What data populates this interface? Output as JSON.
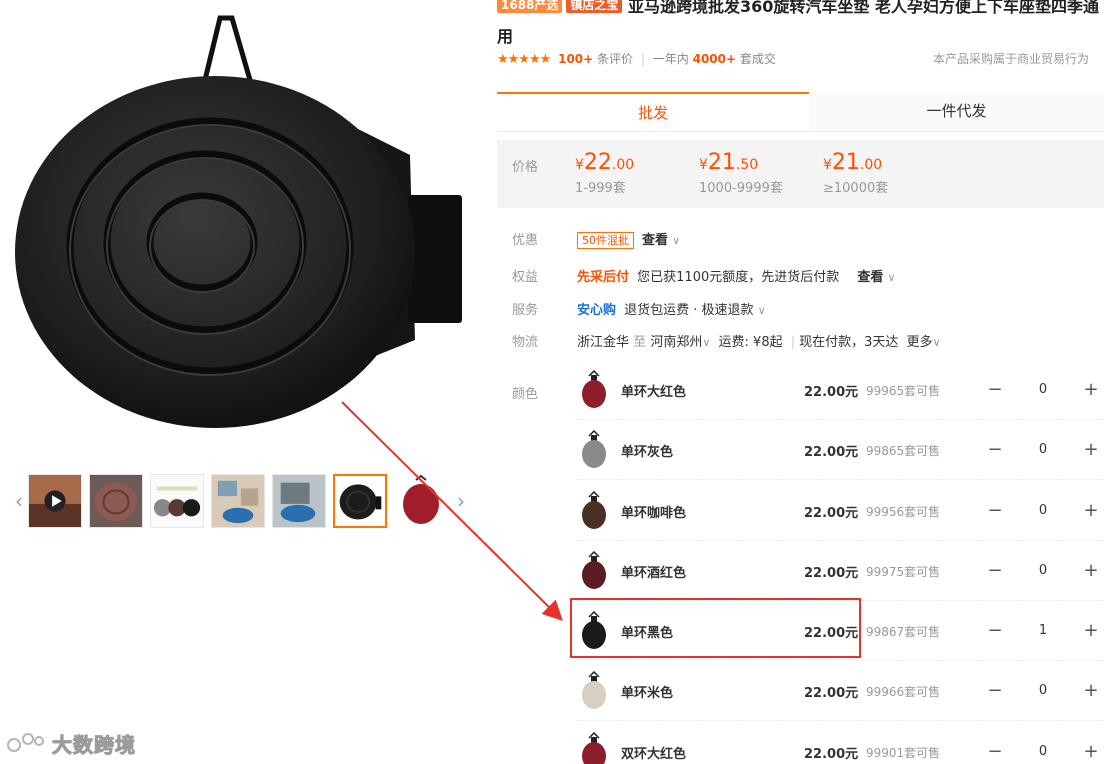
{
  "product": {
    "badges": [
      "1688产选",
      "镇店之宝"
    ],
    "title": "亚马逊跨境批发360旋转汽车坐垫 老人孕妇方便上下车座垫四季通用",
    "stars": "★★★★★",
    "reviews_count": "100+",
    "reviews_label": "条评价",
    "yearly_prefix": "一年内",
    "yearly_count": "4000+",
    "yearly_suffix": "套成交",
    "trade_note": "本产品采购属于商业贸易行为"
  },
  "tabs": [
    {
      "label": "批发",
      "active": true
    },
    {
      "label": "一件代发",
      "active": false
    }
  ],
  "price": {
    "label": "价格",
    "tiers": [
      {
        "yen": "¥",
        "int": "22",
        "dec": ".00",
        "range": "1-999套"
      },
      {
        "yen": "¥",
        "int": "21",
        "dec": ".50",
        "range": "1000-9999套"
      },
      {
        "yen": "¥",
        "int": "21",
        "dec": ".00",
        "range": "≥10000套"
      }
    ]
  },
  "promo": {
    "label": "优惠",
    "tag": "50件混批",
    "link": "查看"
  },
  "benefit": {
    "label": "权益",
    "title": "先采后付",
    "text": "您已获1100元额度，先进货后付款",
    "link": "查看"
  },
  "service": {
    "label": "服务",
    "title": "安心购",
    "text": "退货包运费 · 极速退款"
  },
  "logistics": {
    "label": "物流",
    "from": "浙江金华",
    "to_word": "至",
    "to": "河南郑州",
    "fee": "运费: ¥8起",
    "eta": "现在付款，3天达",
    "more": "更多"
  },
  "colors": {
    "label": "颜色",
    "items": [
      {
        "name": "单环大红色",
        "price": "22.00元",
        "stock": "99965套可售",
        "qty": "0",
        "swatch": "#8c1f2b"
      },
      {
        "name": "单环灰色",
        "price": "22.00元",
        "stock": "99865套可售",
        "qty": "0",
        "swatch": "#8a8a8a"
      },
      {
        "name": "单环咖啡色",
        "price": "22.00元",
        "stock": "99956套可售",
        "qty": "0",
        "swatch": "#4a2f26"
      },
      {
        "name": "单环酒红色",
        "price": "22.00元",
        "stock": "99975套可售",
        "qty": "0",
        "swatch": "#5c1a24"
      },
      {
        "name": "单环黑色",
        "price": "22.00元",
        "stock": "99867套可售",
        "qty": "1",
        "swatch": "#1a1a1a"
      },
      {
        "name": "单环米色",
        "price": "22.00元",
        "stock": "99966套可售",
        "qty": "0",
        "swatch": "#d8cfc3"
      },
      {
        "name": "双环大红色",
        "price": "22.00元",
        "stock": "99901套可售",
        "qty": "0",
        "swatch": "#8c1f2b"
      }
    ]
  },
  "stepper_symbols": {
    "minus": "−",
    "plus": "+"
  },
  "gallery": {
    "prev": "‹",
    "next": "›"
  },
  "watermark": "大数跨境",
  "theme": {
    "accent": "#ff7300",
    "price": "#ff5000",
    "annotation": "#e8312a"
  }
}
